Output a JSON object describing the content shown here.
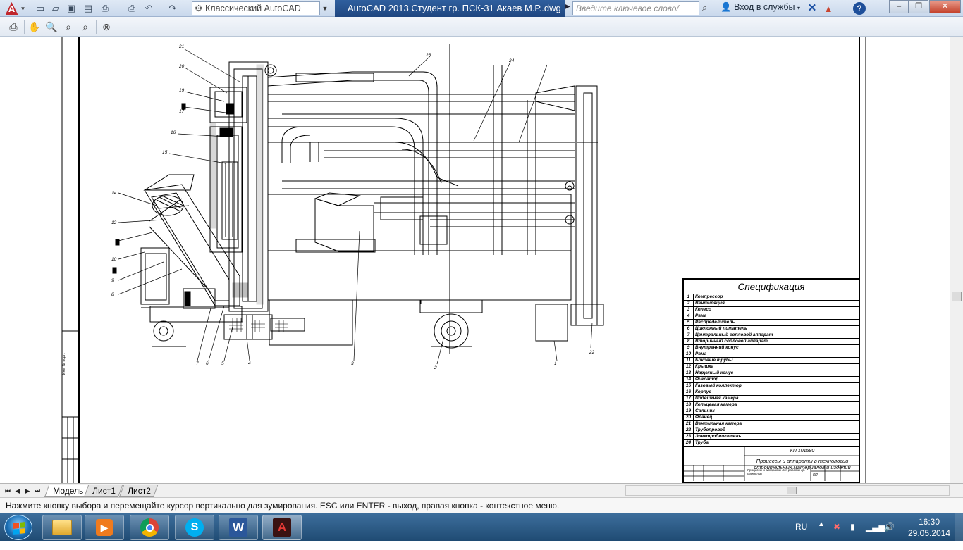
{
  "titlebar": {
    "workspace": "Классический AutoCAD",
    "document_title": "AutoCAD 2013     Студент гр. ПСК-31 Акаев М.Р..dwg",
    "search_placeholder": "Введите ключевое слово/фразу",
    "login_label": "Вход в службы",
    "help_label": "?"
  },
  "drawing": {
    "leader_labels": [
      "21",
      "20",
      "19",
      "17",
      "16",
      "15",
      "14",
      "12",
      "10",
      "9",
      "8",
      "7",
      "6",
      "5",
      "4",
      "3",
      "2",
      "1",
      "22",
      "23",
      "24"
    ],
    "stamp_code": "КП 101580",
    "stamp_name": "Процессы и аппараты в технологии строительных материалов и изделий",
    "stamp_sub": "Процессы и аппараты для работы кр. проектов",
    "stamp_sheet_label": "КП",
    "frame_label": "Инв. № подл."
  },
  "spec": {
    "title": "Спецификация",
    "rows": [
      {
        "n": "1",
        "t": "Компрессор"
      },
      {
        "n": "2",
        "t": "Вентиляция"
      },
      {
        "n": "3",
        "t": "Колесо"
      },
      {
        "n": "4",
        "t": "Рама"
      },
      {
        "n": "5",
        "t": "Распределитель"
      },
      {
        "n": "6",
        "t": "Циклонный питатель"
      },
      {
        "n": "7",
        "t": "Центральный сопловой аппарат"
      },
      {
        "n": "8",
        "t": "Вторичный сопловой аппарат"
      },
      {
        "n": "9",
        "t": "Внутренний конус"
      },
      {
        "n": "10",
        "t": "Рама"
      },
      {
        "n": "11",
        "t": "Боковые трубы"
      },
      {
        "n": "12",
        "t": "Крышка"
      },
      {
        "n": "13",
        "t": "Наружный конус"
      },
      {
        "n": "14",
        "t": "Фиксатор"
      },
      {
        "n": "15",
        "t": "Газовый коллектор"
      },
      {
        "n": "16",
        "t": "Корпус"
      },
      {
        "n": "17",
        "t": "Подвижная камера"
      },
      {
        "n": "18",
        "t": "Кольцевая камера"
      },
      {
        "n": "19",
        "t": "Сальник"
      },
      {
        "n": "20",
        "t": "Фланец"
      },
      {
        "n": "21",
        "t": "Вентильная камера"
      },
      {
        "n": "22",
        "t": "Трубопровод"
      },
      {
        "n": "23",
        "t": "Электродвигатель"
      },
      {
        "n": "24",
        "t": "Труба"
      }
    ]
  },
  "tabs": {
    "model": "Модель",
    "sheet1": "Лист1",
    "sheet2": "Лист2"
  },
  "command_line": "Нажмите кнопку выбора и перемещайте курсор вертикально для зумирования. ESC или ENTER - выход, правая кнопка - контекстное меню.",
  "tray": {
    "language": "RU",
    "time": "16:30",
    "date": "29.05.2014"
  },
  "taskbar_apps": [
    "explorer",
    "media-player",
    "chrome",
    "skype",
    "word",
    "autocad"
  ]
}
